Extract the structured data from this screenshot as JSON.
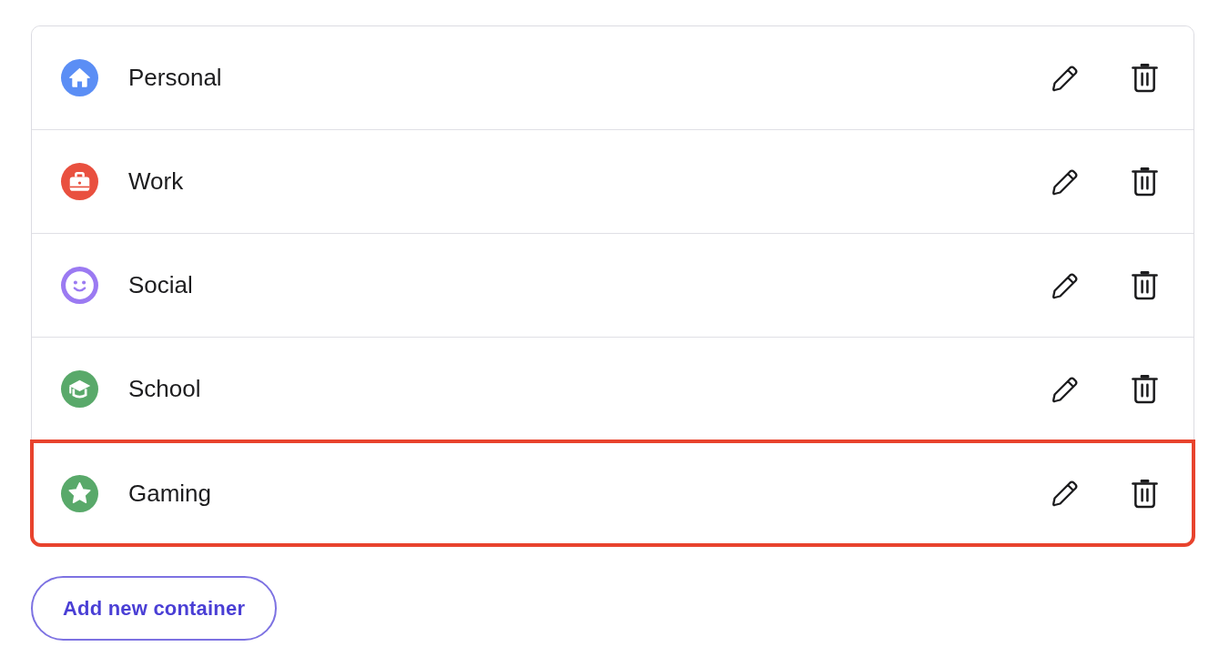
{
  "containers": [
    {
      "kind": "home",
      "color": "#5b8ef5",
      "label": "Personal",
      "highlighted": false
    },
    {
      "kind": "briefcase",
      "color": "#e9503f",
      "label": "Work",
      "highlighted": false
    },
    {
      "kind": "smile",
      "color": "#9b7af2",
      "label": "Social",
      "highlighted": false
    },
    {
      "kind": "cap",
      "color": "#59a96a",
      "label": "School",
      "highlighted": false
    },
    {
      "kind": "star",
      "color": "#59a96a",
      "label": "Gaming",
      "highlighted": true
    }
  ],
  "add_button": {
    "label": "Add new container"
  }
}
